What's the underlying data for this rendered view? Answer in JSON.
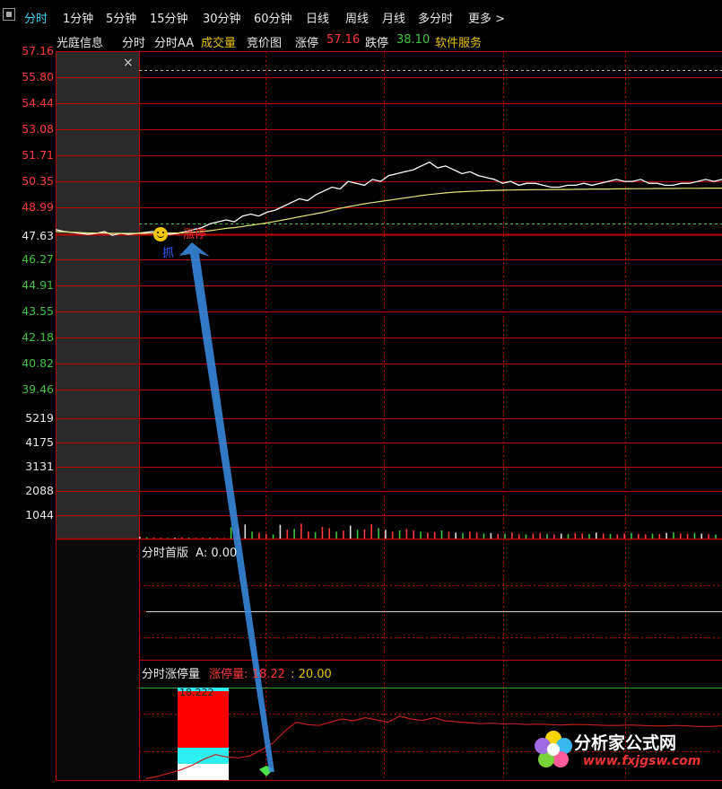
{
  "tabs": [
    {
      "label": "分时",
      "active": true
    },
    {
      "label": "1分钟"
    },
    {
      "label": "5分钟"
    },
    {
      "label": "15分钟"
    },
    {
      "label": "30分钟"
    },
    {
      "label": "60分钟"
    },
    {
      "label": "日线"
    },
    {
      "label": "周线"
    },
    {
      "label": "月线"
    },
    {
      "label": "多分时"
    },
    {
      "label": "更多 >"
    }
  ],
  "subbar": {
    "stock_name": "光庭信息",
    "view1": "分时",
    "view2": "分时AA",
    "volume": "成交量",
    "auction": "竞价图",
    "limit_up_label": "涨停",
    "limit_up_value": "57.16",
    "limit_down_label": "跌停",
    "limit_down_value": "38.10",
    "software_service": "软件服务"
  },
  "price_axis": {
    "up": [
      "57.16",
      "55.80",
      "54.44",
      "53.08",
      "51.71",
      "50.35",
      "48.99"
    ],
    "mid": "47.63",
    "down": [
      "46.27",
      "44.91",
      "43.55",
      "42.18",
      "40.82",
      "39.46"
    ]
  },
  "volume_axis": [
    "5219",
    "4175",
    "3131",
    "2088",
    "1044"
  ],
  "chart_marks": {
    "buy_char": "抓",
    "limit_up_tag": "涨停"
  },
  "panel1": {
    "title": "分时首版",
    "value": "A: 0.00"
  },
  "panel2": {
    "title": "分时涨停量",
    "label": "涨停量",
    "value": "18.22",
    "value2": ": 20.00",
    "box_label": "18.222"
  },
  "watermark": {
    "text": "分析家公式网",
    "url": "www.fxjgsw.com"
  },
  "colors": {
    "up": "#ff3a3a",
    "down": "#3ec43e",
    "grid": "#c00000",
    "price_line": "#ffffff",
    "avg_line": "#e6e67a",
    "active_tab": "#3ad6f5"
  },
  "chart_data": {
    "type": "line",
    "title": "",
    "ylim": [
      38.1,
      57.16
    ],
    "reference_price": 47.63,
    "series": [
      {
        "values": [
          47.9,
          47.8,
          47.75,
          47.7,
          47.65,
          47.7,
          47.8,
          47.6,
          47.7,
          47.65,
          47.7,
          47.75,
          47.8,
          47.7,
          47.65,
          47.7,
          47.8,
          47.9,
          48.0,
          48.2,
          48.3,
          48.4,
          48.3,
          48.6,
          48.7,
          48.6,
          48.8,
          48.9,
          49.1,
          49.3,
          49.5,
          49.4,
          49.7,
          49.9,
          50.1,
          50.0,
          50.4,
          50.3,
          50.2,
          50.5,
          50.4,
          50.7,
          50.8,
          50.9,
          51.0,
          51.2,
          51.4,
          51.1,
          51.2,
          51.0,
          50.8,
          50.9,
          50.7,
          50.6,
          50.5,
          50.3,
          50.4,
          50.2,
          50.3,
          50.3,
          50.2,
          50.1,
          50.1,
          50.2,
          50.2,
          50.3,
          50.2,
          50.3,
          50.4,
          50.5,
          50.4,
          50.4,
          50.5,
          50.3,
          50.3,
          50.2,
          50.2,
          50.3,
          50.3,
          50.4,
          50.5,
          50.4,
          50.5
        ]
      },
      {
        "values": [
          47.8,
          47.78,
          47.76,
          47.74,
          47.72,
          47.72,
          47.72,
          47.7,
          47.7,
          47.7,
          47.7,
          47.7,
          47.72,
          47.72,
          47.72,
          47.72,
          47.74,
          47.76,
          47.8,
          47.84,
          47.9,
          47.96,
          48.0,
          48.06,
          48.12,
          48.18,
          48.24,
          48.32,
          48.4,
          48.48,
          48.56,
          48.64,
          48.72,
          48.8,
          48.9,
          49.0,
          49.08,
          49.16,
          49.24,
          49.3,
          49.36,
          49.42,
          49.48,
          49.54,
          49.6,
          49.66,
          49.72,
          49.76,
          49.8,
          49.84,
          49.86,
          49.88,
          49.9,
          49.92,
          49.93,
          49.94,
          49.95,
          49.96,
          49.96,
          49.97,
          49.97,
          49.98,
          49.98,
          49.98,
          49.99,
          49.99,
          50.0,
          50.0,
          50.0,
          50.01,
          50.01,
          50.02,
          50.02,
          50.02,
          50.03,
          50.03,
          50.03,
          50.04,
          50.04,
          50.04,
          50.05,
          50.05,
          50.05
        ]
      }
    ],
    "volume_ylim": [
      0,
      5219
    ],
    "volume": [
      80,
      60,
      40,
      30,
      25,
      30,
      50,
      40,
      30,
      35,
      40,
      30,
      25,
      500,
      420,
      610,
      300,
      250,
      200,
      180,
      600,
      380,
      420,
      650,
      300,
      280,
      500,
      450,
      300,
      350,
      560,
      380,
      400,
      620,
      450,
      380,
      300,
      350,
      420,
      360,
      300,
      260,
      280,
      350,
      300,
      260,
      240,
      300,
      260,
      220,
      240,
      200,
      220,
      260,
      200,
      180,
      220,
      240,
      200,
      180,
      220,
      200,
      240,
      220,
      200,
      260,
      220,
      200,
      180,
      220,
      240,
      200,
      180,
      220,
      200,
      240,
      260,
      220,
      200,
      240,
      220,
      200,
      180
    ],
    "limit_volume": [
      0.3,
      0.8,
      1.5,
      2.2,
      3.2,
      4.5,
      5.5,
      5.0,
      4.8,
      5.2,
      6.5,
      8.0,
      10.5,
      12.5,
      12.0,
      11.8,
      12.5,
      13.2,
      12.8,
      13.5,
      13.0,
      12.5,
      13.8,
      13.2,
      12.9,
      13.5,
      12.8,
      12.6,
      12.4,
      12.2,
      12.3,
      12.1,
      12.2,
      12.0,
      12.1,
      12.0,
      11.9,
      12.0,
      12.0,
      11.9,
      11.8,
      11.8,
      11.9,
      11.8,
      11.7,
      11.7,
      11.8,
      11.7,
      11.6,
      11.6,
      11.7
    ]
  }
}
